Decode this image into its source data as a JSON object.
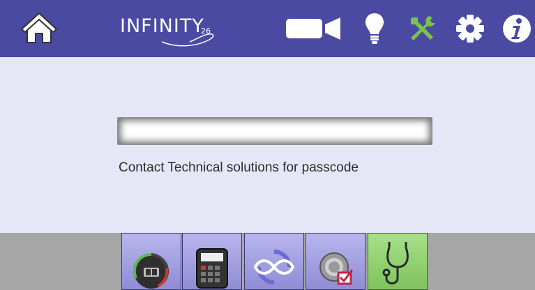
{
  "header": {
    "logo_text": "INFINITY",
    "logo_number": "26",
    "icons": [
      "home-icon",
      "camera-icon",
      "lightbulb-icon",
      "tools-icon",
      "gear-icon",
      "info-icon"
    ],
    "tools_color": "#7bc24a",
    "bar_color": "#4a4aa3"
  },
  "main": {
    "passcode_value": "",
    "hint": "Contact Technical solutions for passcode"
  },
  "bottom_nav": {
    "items": [
      "meter-icon",
      "calculator-icon",
      "infinity-cycle-icon",
      "checklist-icon",
      "stethoscope-icon"
    ],
    "active": "stethoscope-icon",
    "active_color": "#8fd06a"
  }
}
